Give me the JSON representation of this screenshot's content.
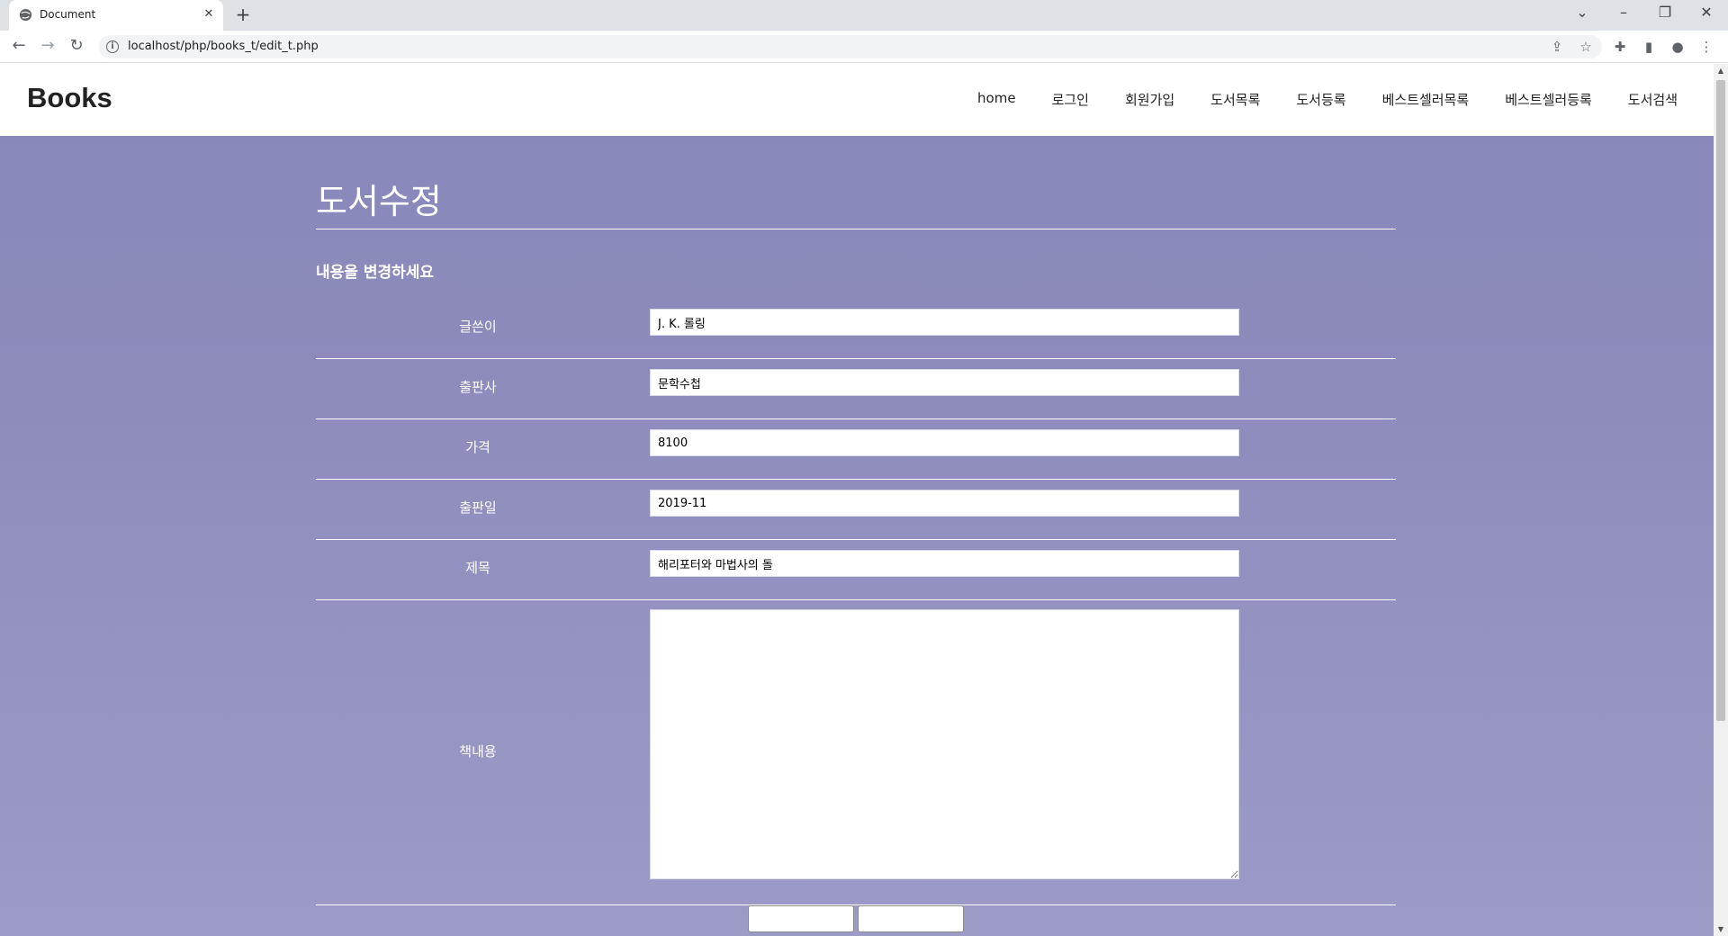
{
  "browser": {
    "tab_title": "Document",
    "url": "localhost/php/books_t/edit_t.php",
    "icons": [
      "globe-icon",
      "close-icon",
      "plus-icon",
      "back-icon",
      "forward-icon",
      "reload-icon",
      "info-icon",
      "share-icon",
      "star-icon",
      "extensions-icon",
      "sidebar-icon",
      "profile-icon",
      "menu-icon"
    ]
  },
  "header": {
    "logo": "Books",
    "nav": [
      "home",
      "로그인",
      "회원가입",
      "도서목록",
      "도서등록",
      "베스트셀러목록",
      "베스트셀러등록",
      "도서검색"
    ]
  },
  "main": {
    "title": "도서수정",
    "subtitle": "내용을 변경하세요",
    "fields": [
      {
        "label": "글쓴이",
        "value": "J. K. 롤링"
      },
      {
        "label": "출판사",
        "value": "문학수첩"
      },
      {
        "label": "가격",
        "value": "8100"
      },
      {
        "label": "출판일",
        "value": "2019-11"
      },
      {
        "label": "제목",
        "value": "해리포터와 마법사의 돌"
      }
    ],
    "content_label": "책내용",
    "content_value": ""
  },
  "colors": {
    "page_bg": "#8888bb",
    "page_text": "#ffffff"
  }
}
